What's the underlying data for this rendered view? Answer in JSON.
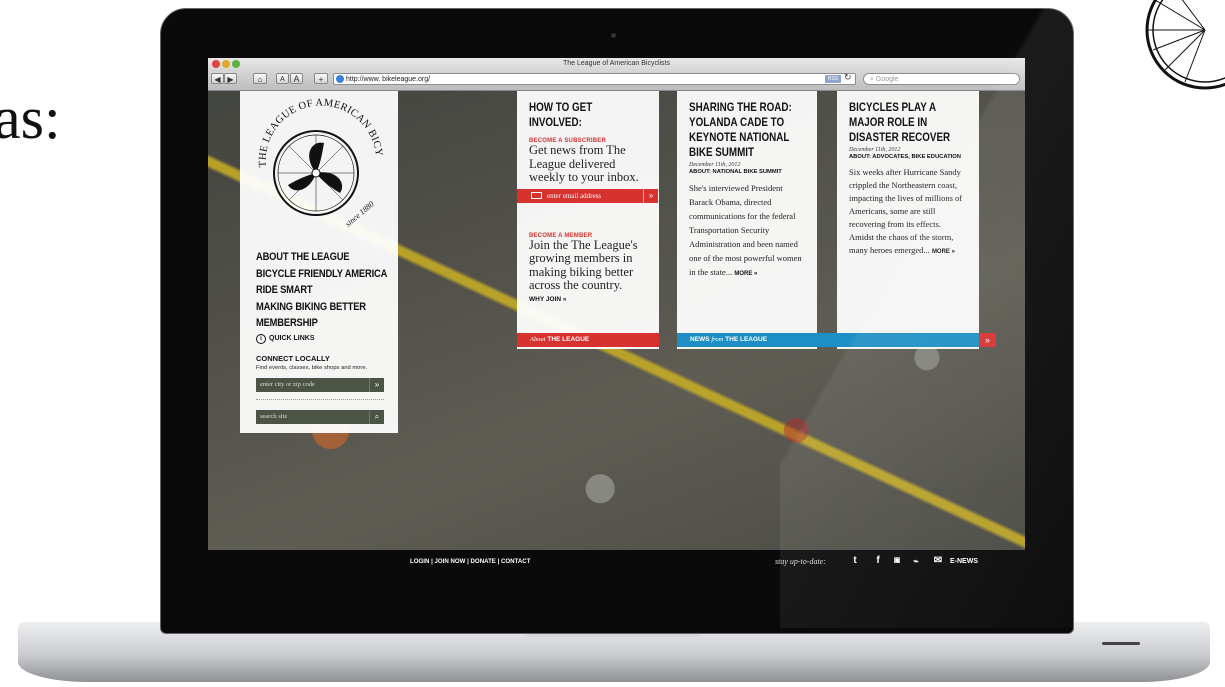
{
  "slide": {
    "fragment": "as:"
  },
  "browser": {
    "window_title": "The League of American Bicyclists",
    "url": "http://www. bikeleague.org/",
    "search_placeholder": "Google",
    "rss_label": "RSS",
    "font_small": "A",
    "font_large": "A",
    "add_label": "+"
  },
  "left_panel": {
    "nav": [
      "ABOUT THE LEAGUE",
      "BICYCLE FRIENDLY AMERICA",
      "RIDE SMART",
      "MAKING BIKING BETTER",
      "MEMBERSHIP"
    ],
    "quick_links": "QUICK LINKS",
    "connect_heading": "CONNECT LOCALLY",
    "connect_sub": "Find events, classes, bike shops and more.",
    "city_placeholder": "enter city or zip code",
    "search_placeholder": "search site"
  },
  "involved": {
    "title": "HOW TO GET INVOLVED:",
    "sub_label": "BECOME A SUBSCRIBER",
    "sub_text": "Get news from The League delivered weekly to your inbox.",
    "email_placeholder": "enter email address",
    "member_label": "BECOME A MEMBER",
    "member_text": "Join the The League's growing members in making biking better across the country.",
    "why_join": "WHY JOIN »"
  },
  "news1": {
    "title": "SHARING THE ROAD: YOLANDA CADE TO KEYNOTE NATIONAL BIKE SUMMIT",
    "date": "December 11th, 2012",
    "about": "ABOUT: NATIONAL BIKE SUMMIT",
    "body": "She's interviewed President Barack Obama, directed communications for the federal Transportation Security Administration and been named one of the most powerful women in the state...",
    "more": "MORE »"
  },
  "news2": {
    "title": "BICYCLES PLAY A MAJOR ROLE IN DISASTER RECOVER",
    "date": "December 11th, 2012",
    "about": "ABOUT: ADVOCATES, BIKE EDUCATION",
    "body": "Six weeks after Hurricane Sandy crippled the Northeastern coast, impacting the lives of millions of Americans, some are still recovering from its effects. Amidst the chaos of the storm, many heroes emerged...",
    "more": "MORE »"
  },
  "strips": {
    "about_italic": "About",
    "about_bold": "THE LEAGUE",
    "news_bold1": "NEWS",
    "news_italic": "from",
    "news_bold2": "THE LEAGUE",
    "arrow": "»"
  },
  "footer": {
    "links": "LOGIN | JOIN NOW | DONATE | CONTACT",
    "stay": "stay up-to-date:",
    "enews": "E-NEWS"
  },
  "colors": {
    "accent_red": "#d8322f",
    "accent_blue": "#1d8fc4",
    "input_dark": "#4c5446"
  }
}
